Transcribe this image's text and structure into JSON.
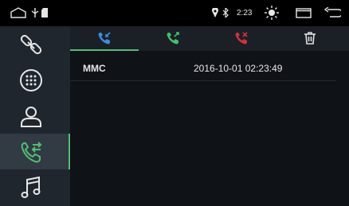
{
  "status_bar": {
    "time": "2:23",
    "icons": [
      "home-outline-icon",
      "usb-icon",
      "sd-card-icon",
      "location-icon",
      "bluetooth-icon",
      "brightness-icon",
      "window-icon",
      "back-icon"
    ]
  },
  "sidebar": {
    "items": [
      {
        "name": "link-icon",
        "active": false
      },
      {
        "name": "dialpad-icon",
        "active": false
      },
      {
        "name": "contacts-icon",
        "active": false
      },
      {
        "name": "call-log-icon",
        "active": true
      },
      {
        "name": "music-icon",
        "active": false
      }
    ]
  },
  "tabs": [
    {
      "name": "incoming-calls-icon",
      "color": "#3a8fe0",
      "active": true
    },
    {
      "name": "outgoing-calls-icon",
      "color": "#3fc36a",
      "active": false
    },
    {
      "name": "missed-calls-icon",
      "color": "#d6303a",
      "active": false
    },
    {
      "name": "delete-icon",
      "color": "#e0e0e0",
      "active": false
    }
  ],
  "call_log": [
    {
      "name": "MMC",
      "datetime": "2016-10-01 02:23:49"
    }
  ],
  "colors": {
    "accent": "#4ec072",
    "sidebar_bg": "#20262e",
    "main_bg": "#0f1217"
  }
}
